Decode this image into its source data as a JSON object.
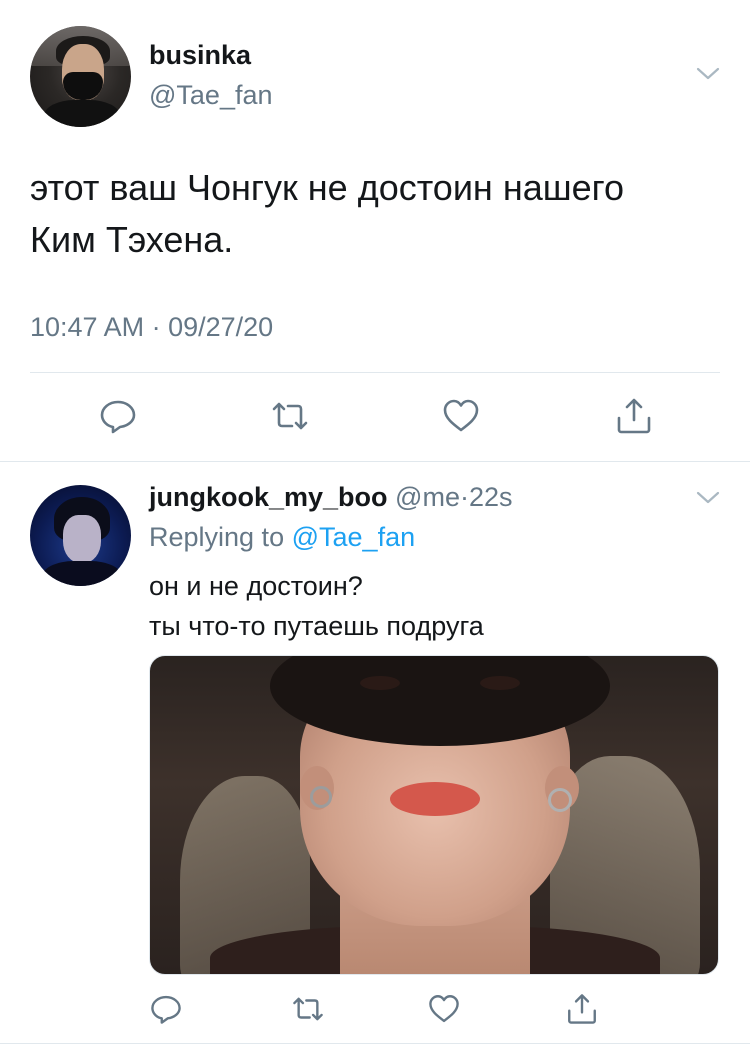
{
  "main_tweet": {
    "display_name": "businka",
    "handle": "@Tae_fan",
    "text_line1": "этот ваш Чонгук не достоин нашего",
    "text_line2": "Ким Тэхена.",
    "timestamp": "10:47 AM · 09/27/20",
    "actions": [
      "reply-icon",
      "retweet-icon",
      "like-icon",
      "share-icon"
    ]
  },
  "reply_tweet": {
    "display_name": "jungkook_my_boo",
    "handle": "@me",
    "separator": "·",
    "age": "22s",
    "replying_prefix": "Replying to",
    "replying_handle": "@Tae_fan",
    "text_line1": "он и не достоин?",
    "text_line2": "ты что-то путаешь подруга",
    "actions": [
      "reply-icon",
      "retweet-icon",
      "like-icon",
      "share-icon"
    ]
  },
  "colors": {
    "text": "#14171a",
    "secondary": "#657786",
    "link": "#1da1f2",
    "icon": "#657786",
    "divider": "#e1e8ed"
  }
}
